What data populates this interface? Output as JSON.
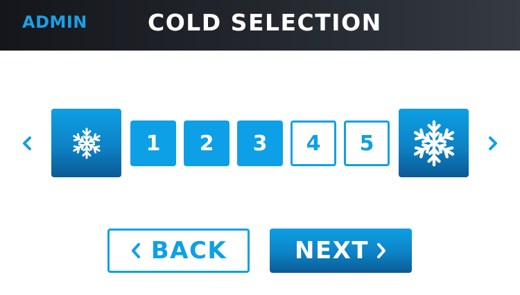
{
  "header": {
    "admin_label": "ADMIN",
    "title": "COLD SELECTION",
    "admin_color": "#1aa0e6"
  },
  "selector": {
    "levels": [
      {
        "label": "1",
        "selected": true
      },
      {
        "label": "2",
        "selected": true
      },
      {
        "label": "3",
        "selected": true
      },
      {
        "label": "4",
        "selected": false
      },
      {
        "label": "5",
        "selected": false
      }
    ],
    "current_level": 3,
    "max_level": 5,
    "left_icon": "snowflake-small-icon",
    "right_icon": "snowflake-large-icon",
    "prev_icon": "chevron-left-icon",
    "next_icon": "chevron-right-icon"
  },
  "footer": {
    "back_label": "BACK",
    "next_label": "NEXT",
    "accent_color": "#0ea0e6"
  }
}
